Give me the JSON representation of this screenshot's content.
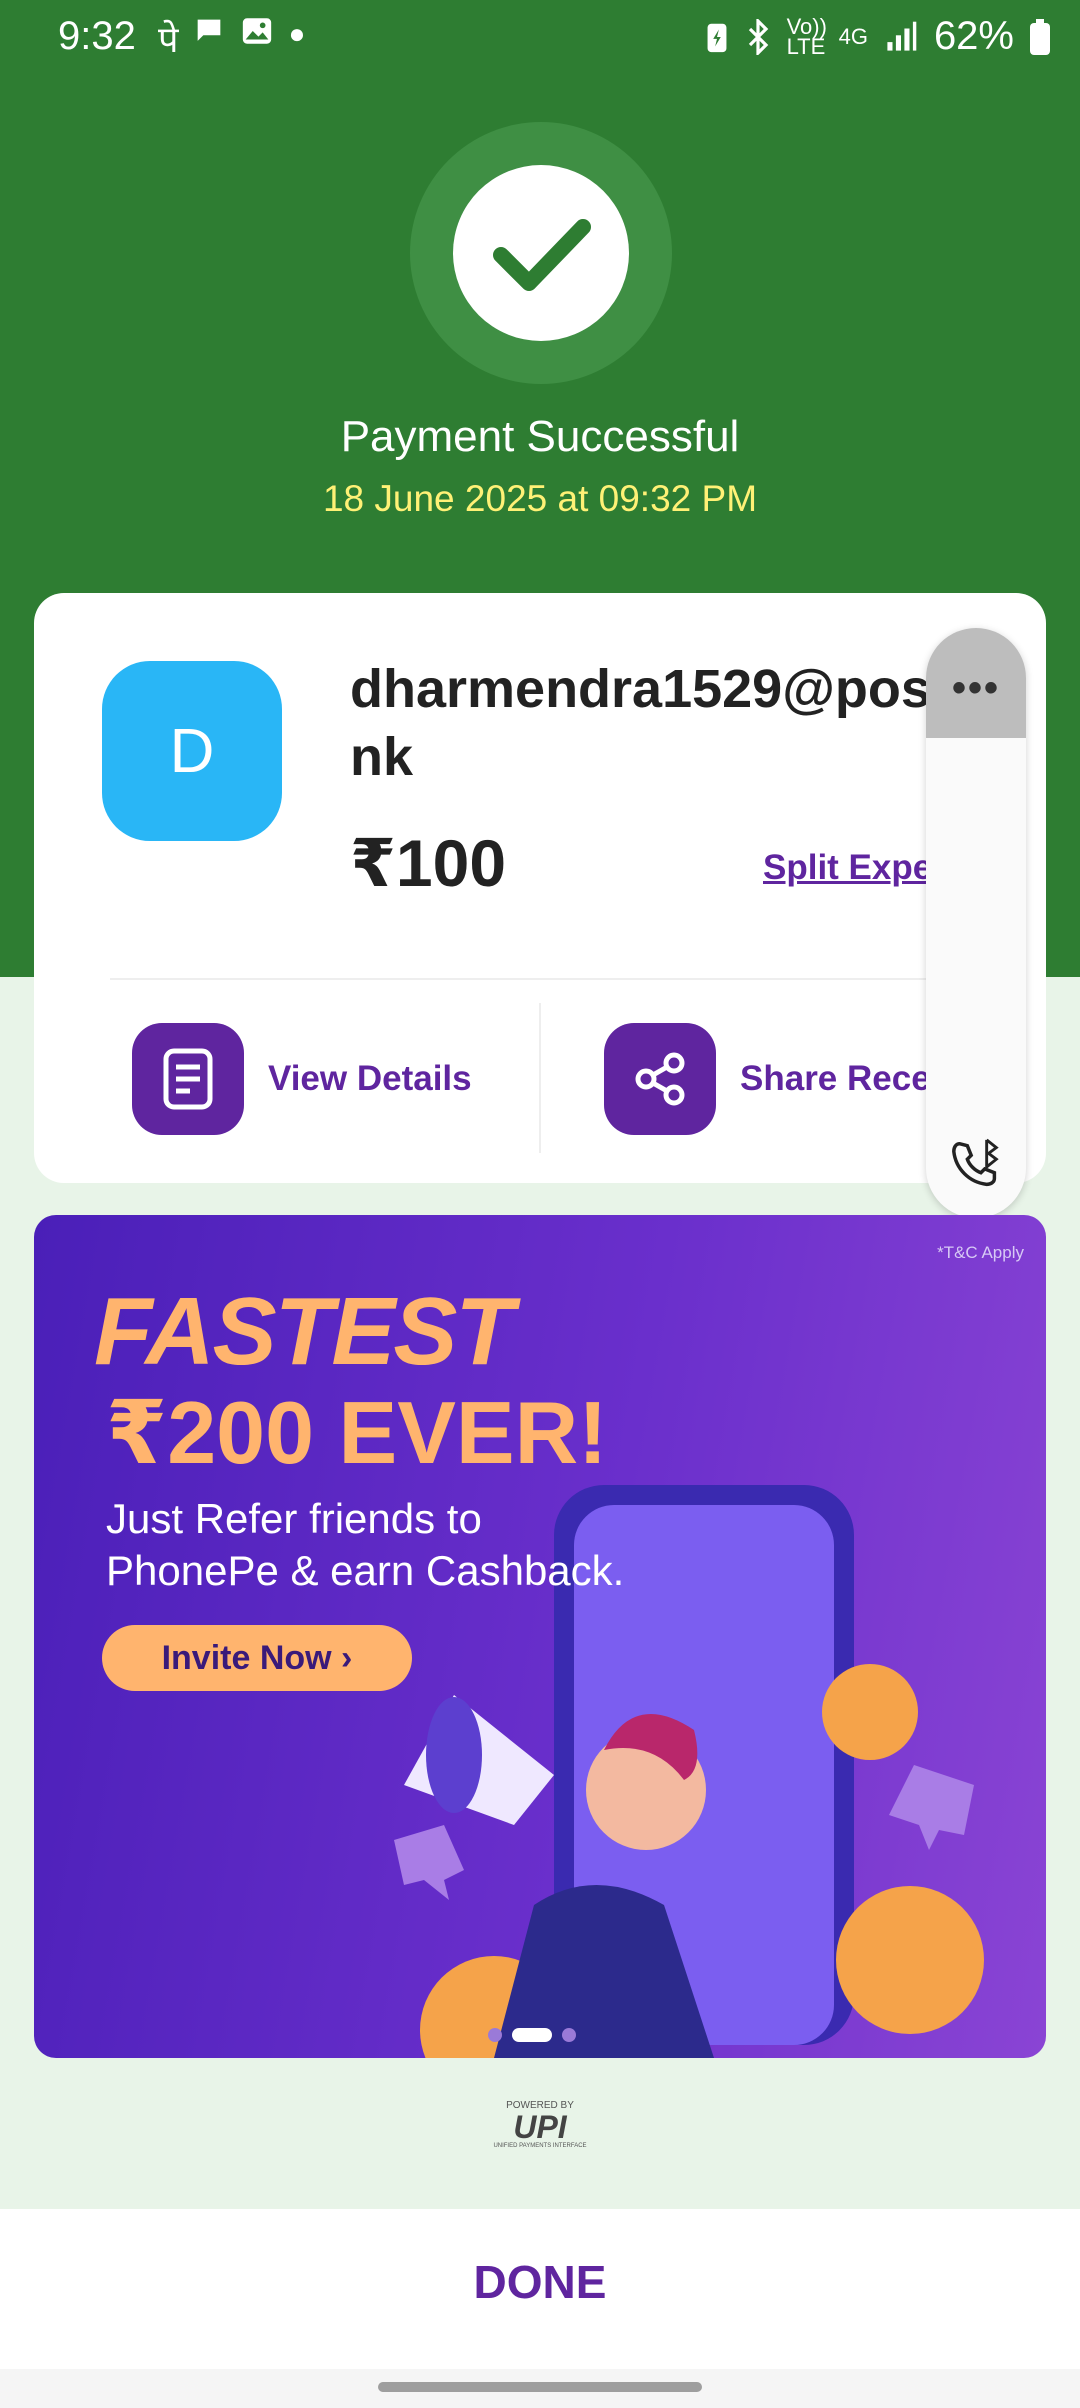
{
  "status_bar": {
    "time": "9:32",
    "left_icons": [
      "phonepe-icon",
      "chat-icon",
      "gallery-icon",
      "dot-icon"
    ],
    "volte": "Vo)) LTE",
    "network": "4G",
    "battery": "62%"
  },
  "header": {
    "title": "Payment Successful",
    "datetime": "18 June 2025 at 09:32 PM"
  },
  "card": {
    "avatar_letter": "D",
    "payee": "dharmendra1529@postbank",
    "amount": "₹100",
    "split_label": "Split Expense",
    "view_details": "View Details",
    "share_receipt": "Share Receipt"
  },
  "banner": {
    "tc": "*T&C Apply",
    "headline1": "FASTEST",
    "headline2": "₹200 EVER!",
    "body": "Just Refer friends to\nPhonePe & earn Cashback.",
    "cta": "Invite Now ›"
  },
  "upi": {
    "powered_by": "POWERED BY",
    "logo": "UPI",
    "subtitle": "UNIFIED PAYMENTS INTERFACE"
  },
  "footer": {
    "done": "DONE"
  },
  "colors": {
    "green": "#2e7d32",
    "purple": "#5f259f",
    "yellow": "#fff176",
    "avatar": "#29b6f6"
  }
}
